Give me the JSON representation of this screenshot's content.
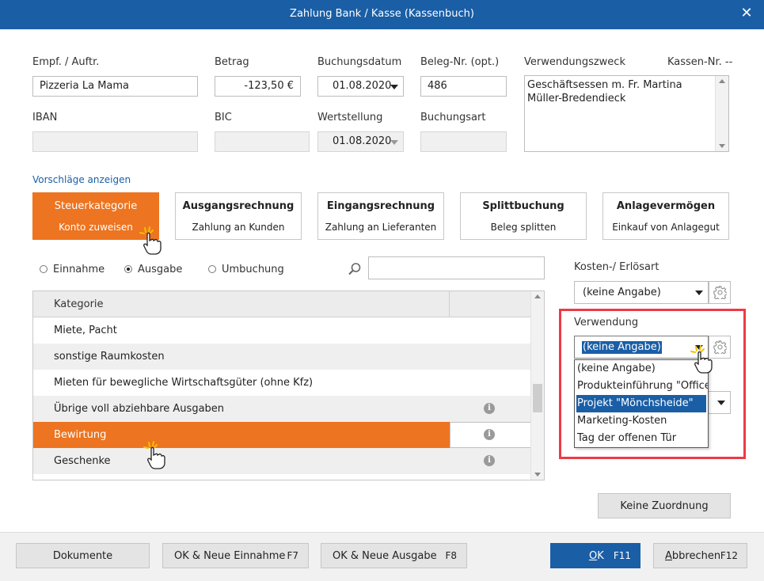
{
  "window": {
    "title": "Zahlung Bank / Kasse (Kassenbuch)",
    "close_glyph": "✕"
  },
  "form": {
    "empf_label": "Empf. / Auftr.",
    "empf_value": "Pizzeria La Mama",
    "betrag_label": "Betrag",
    "betrag_value": "-123,50 €",
    "buchungsdatum_label": "Buchungsdatum",
    "buchungsdatum_value": "01.08.2020",
    "belegnr_label": "Beleg-Nr. (opt.)",
    "belegnr_value": "486",
    "verwendungszweck_label": "Verwendungszweck",
    "verwendungszweck_value": "Geschäftsessen m. Fr. Martina Müller-Bredendieck",
    "kassennr_label": "Kassen-Nr. --",
    "iban_label": "IBAN",
    "iban_value": "",
    "bic_label": "BIC",
    "bic_value": "",
    "wertstellung_label": "Wertstellung",
    "wertstellung_value": "01.08.2020",
    "buchungsart_label": "Buchungsart",
    "buchungsart_value": ""
  },
  "suggestions_link": "Vorschläge anzeigen",
  "mode_buttons": [
    {
      "title": "Steuerkategorie",
      "sub": "Konto zuweisen",
      "active": true
    },
    {
      "title": "Ausgangsrechnung",
      "sub": "Zahlung an Kunden",
      "active": false
    },
    {
      "title": "Eingangsrechnung",
      "sub": "Zahlung an Lieferanten",
      "active": false
    },
    {
      "title": "Splittbuchung",
      "sub": "Beleg splitten",
      "active": false
    },
    {
      "title": "Anlagevermögen",
      "sub": "Einkauf von Anlagegut",
      "active": false
    }
  ],
  "radios": {
    "einnahme": "Einnahme",
    "ausgabe": "Ausgabe",
    "umbuchung": "Umbuchung",
    "selected": "ausgabe"
  },
  "search": {
    "value": ""
  },
  "table": {
    "header": "Kategorie",
    "rows": [
      {
        "label": "Miete, Pacht",
        "info": false
      },
      {
        "label": "sonstige Raumkosten",
        "info": false
      },
      {
        "label": "Mieten für bewegliche Wirtschaftsgüter (ohne Kfz)",
        "info": false
      },
      {
        "label": "Übrige voll abziehbare Ausgaben",
        "info": true
      },
      {
        "label": "Bewirtung",
        "info": true,
        "selected": true
      },
      {
        "label": "Geschenke",
        "info": true
      }
    ]
  },
  "right_panel": {
    "kosten_label": "Kosten-/ Erlösart",
    "kosten_value": "(keine Angabe)",
    "verwendung_label": "Verwendung",
    "verwendung_value": "(keine Angabe)",
    "verwendung_options": [
      "(keine Angabe)",
      "Produkteinführung \"OfficePr",
      "Projekt \"Mönchsheide\"",
      "Marketing-Kosten",
      "Tag der offenen Tür"
    ],
    "highlighted_option": 2,
    "keine_zuordnung": "Keine Zuordnung"
  },
  "footer": {
    "dokumente": "Dokumente",
    "ok_neue_einnahme": "OK & Neue Einnahme",
    "ok_neue_einnahme_key": "F7",
    "ok_neue_ausgabe": "OK & Neue Ausgabe",
    "ok_neue_ausgabe_key": "F8",
    "ok_first": "O",
    "ok_rest": "K",
    "ok_key": "F11",
    "abbrechen_first": "A",
    "abbrechen_rest": "bbrechen",
    "abbrechen_key": "F12"
  },
  "colors": {
    "accent_orange": "#ed7420",
    "title_blue": "#1a5ea6",
    "highlight_red": "#ee3a45"
  }
}
